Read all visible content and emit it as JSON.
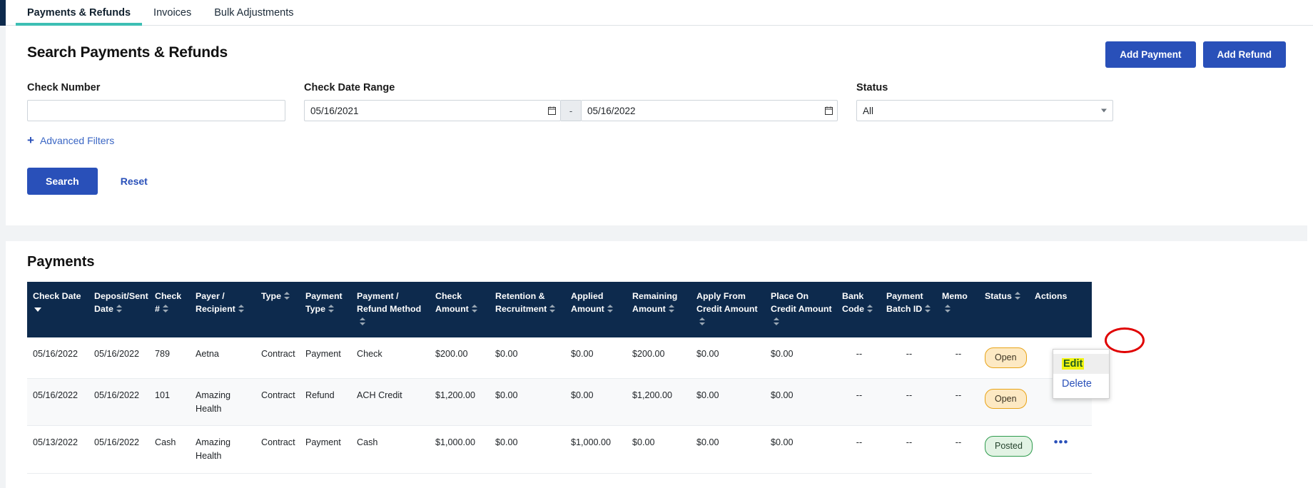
{
  "tabs": [
    {
      "label": "Payments & Refunds",
      "active": true
    },
    {
      "label": "Invoices",
      "active": false
    },
    {
      "label": "Bulk Adjustments",
      "active": false
    }
  ],
  "search_card": {
    "title": "Search Payments & Refunds",
    "add_payment_label": "Add Payment",
    "add_refund_label": "Add Refund",
    "check_number_label": "Check Number",
    "check_number_value": "",
    "check_date_range_label": "Check Date Range",
    "date_from": "05/16/2021",
    "date_separator": "-",
    "date_to": "05/16/2022",
    "status_label": "Status",
    "status_value": "All",
    "advanced_filters_label": "Advanced Filters",
    "advanced_filters_plus": "+",
    "search_label": "Search",
    "reset_label": "Reset"
  },
  "table": {
    "title": "Payments",
    "columns": [
      {
        "label": "Check Date",
        "sort": "desc"
      },
      {
        "label": "Deposit/Sent Date",
        "sort": "both"
      },
      {
        "label": "Check #",
        "sort": "both"
      },
      {
        "label": "Payer / Recipient",
        "sort": "both"
      },
      {
        "label": "Type",
        "sort": "both"
      },
      {
        "label": "Payment Type",
        "sort": "both"
      },
      {
        "label": "Payment / Refund Method",
        "sort": "both"
      },
      {
        "label": "Check Amount",
        "sort": "both"
      },
      {
        "label": "Retention & Recruitment",
        "sort": "both"
      },
      {
        "label": "Applied Amount",
        "sort": "both"
      },
      {
        "label": "Remaining Amount",
        "sort": "both"
      },
      {
        "label": "Apply From Credit Amount",
        "sort": "both"
      },
      {
        "label": "Place On Credit Amount",
        "sort": "both"
      },
      {
        "label": "Bank Code",
        "sort": "both"
      },
      {
        "label": "Payment Batch ID",
        "sort": "both"
      },
      {
        "label": "Memo",
        "sort": "both"
      },
      {
        "label": "Status",
        "sort": "both"
      },
      {
        "label": "Actions",
        "sort": "none"
      }
    ],
    "rows": [
      {
        "check_date": "05/16/2022",
        "deposit_sent_date": "05/16/2022",
        "check_number": "789",
        "payer_recipient": "Aetna",
        "type": "Contract",
        "payment_type": "Payment",
        "method": "Check",
        "check_amount": "$200.00",
        "retention_recruitment": "$0.00",
        "applied_amount": "$0.00",
        "remaining_amount": "$200.00",
        "apply_from_credit_amount": "$0.00",
        "place_on_credit_amount": "$0.00",
        "bank_code": "--",
        "payment_batch_id": "--",
        "memo": "--",
        "status": "Open",
        "actions": "•••"
      },
      {
        "check_date": "05/16/2022",
        "deposit_sent_date": "05/16/2022",
        "check_number": "101",
        "payer_recipient": "Amazing Health",
        "type": "Contract",
        "payment_type": "Refund",
        "method": "ACH Credit",
        "check_amount": "$1,200.00",
        "retention_recruitment": "$0.00",
        "applied_amount": "$0.00",
        "remaining_amount": "$1,200.00",
        "apply_from_credit_amount": "$0.00",
        "place_on_credit_amount": "$0.00",
        "bank_code": "--",
        "payment_batch_id": "--",
        "memo": "--",
        "status": "Open",
        "actions": ""
      },
      {
        "check_date": "05/13/2022",
        "deposit_sent_date": "05/16/2022",
        "check_number": "Cash",
        "payer_recipient": "Amazing Health",
        "type": "Contract",
        "payment_type": "Payment",
        "method": "Cash",
        "check_amount": "$1,000.00",
        "retention_recruitment": "$0.00",
        "applied_amount": "$1,000.00",
        "remaining_amount": "$0.00",
        "apply_from_credit_amount": "$0.00",
        "place_on_credit_amount": "$0.00",
        "bank_code": "--",
        "payment_batch_id": "--",
        "memo": "--",
        "status": "Posted",
        "actions": "•••"
      }
    ]
  },
  "context_menu": {
    "edit_label": "Edit",
    "delete_label": "Delete"
  },
  "colors": {
    "accent_teal": "#3dbfb4",
    "primary_blue": "#2950b9",
    "header_navy": "#0d2a4d",
    "badge_open": "#e8a317",
    "badge_posted": "#2e9b4d",
    "highlight_yellow": "#f2f512",
    "annotation_red": "#e00000"
  }
}
